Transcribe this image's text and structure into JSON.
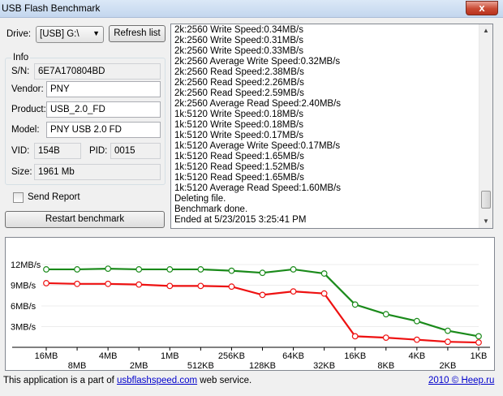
{
  "window": {
    "title": "USB Flash Benchmark",
    "close_label": "x"
  },
  "drive": {
    "label": "Drive:",
    "value": "[USB] G:\\",
    "refresh_label": "Refresh list"
  },
  "info": {
    "group_title": "Info",
    "sn_label": "S/N:",
    "sn_value": "6E7A170804BD",
    "vendor_label": "Vendor:",
    "vendor_value": "PNY",
    "product_label": "Product:",
    "product_value": "USB_2.0_FD",
    "model_label": "Model:",
    "model_value": "PNY USB 2.0 FD",
    "vid_label": "VID:",
    "vid_value": "154B",
    "pid_label": "PID:",
    "pid_value": "0015",
    "size_label": "Size:",
    "size_value": "1961 Mb"
  },
  "send_report_label": "Send Report",
  "restart_label": "Restart benchmark",
  "log": [
    "2k:2560 Write Speed:0.34MB/s",
    "2k:2560 Write Speed:0.31MB/s",
    "2k:2560 Write Speed:0.33MB/s",
    "2k:2560 Average Write Speed:0.32MB/s",
    "2k:2560 Read Speed:2.38MB/s",
    "2k:2560 Read Speed:2.26MB/s",
    "2k:2560 Read Speed:2.59MB/s",
    "2k:2560 Average Read Speed:2.40MB/s",
    "1k:5120 Write Speed:0.18MB/s",
    "1k:5120 Write Speed:0.18MB/s",
    "1k:5120 Write Speed:0.17MB/s",
    "1k:5120 Average Write Speed:0.17MB/s",
    "1k:5120 Read Speed:1.65MB/s",
    "1k:5120 Read Speed:1.52MB/s",
    "1k:5120 Read Speed:1.65MB/s",
    "1k:5120 Average Read Speed:1.60MB/s",
    "Deleting file.",
    "Benchmark done.",
    "Ended at 5/23/2015 3:25:41 PM"
  ],
  "chart_data": {
    "type": "line",
    "x_top": [
      "16MB",
      "4MB",
      "1MB",
      "256KB",
      "64KB",
      "16KB",
      "4KB",
      "1KB"
    ],
    "x_bottom": [
      "8MB",
      "2MB",
      "512KB",
      "128KB",
      "32KB",
      "8KB",
      "2KB"
    ],
    "categories": [
      "16MB",
      "8MB",
      "4MB",
      "2MB",
      "1MB",
      "512KB",
      "256KB",
      "128KB",
      "64KB",
      "32KB",
      "16KB",
      "8KB",
      "4KB",
      "2KB",
      "1KB"
    ],
    "y_ticks": [
      "3MB/s",
      "6MB/s",
      "9MB/s",
      "12MB/s"
    ],
    "ylim": [
      0,
      15
    ],
    "series": [
      {
        "color": "#1a8a1a",
        "values": [
          11.3,
          11.3,
          11.4,
          11.3,
          11.3,
          11.3,
          11.1,
          10.8,
          11.3,
          10.7,
          6.2,
          4.8,
          3.8,
          2.4,
          1.6
        ]
      },
      {
        "color": "#ee1111",
        "values": [
          9.3,
          9.2,
          9.2,
          9.1,
          8.9,
          8.9,
          8.8,
          7.6,
          8.1,
          7.8,
          1.6,
          1.4,
          1.1,
          0.8,
          0.7
        ]
      }
    ]
  },
  "footer": {
    "left_prefix": "This application is a part of ",
    "left_link": "usbflashspeed.com",
    "left_suffix": " web service.",
    "right_link": "2010 © Heep.ru"
  }
}
